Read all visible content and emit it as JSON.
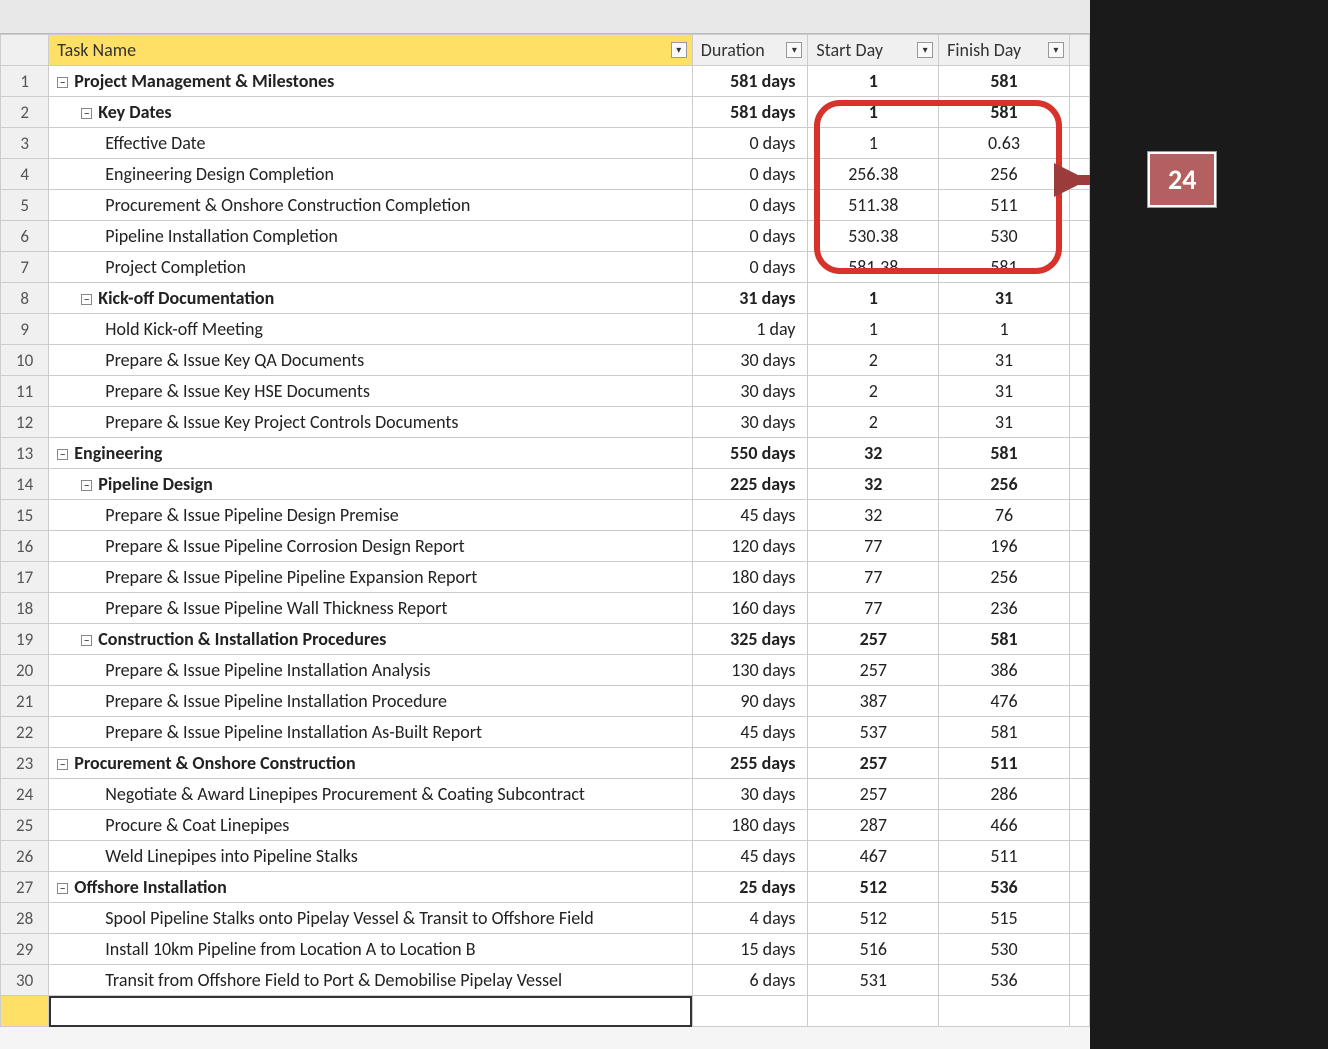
{
  "callout": {
    "label": "24"
  },
  "headers": {
    "task": "Task Name",
    "duration": "Duration",
    "start": "Start Day",
    "finish": "Finish Day"
  },
  "rows": [
    {
      "n": "1",
      "bold": true,
      "lvl": 0,
      "toggle": true,
      "name": "Project Management & Milestones",
      "dur": "581 days",
      "start": "1",
      "finish": "581"
    },
    {
      "n": "2",
      "bold": true,
      "lvl": 1,
      "toggle": true,
      "name": "Key Dates",
      "dur": "581 days",
      "start": "1",
      "finish": "581"
    },
    {
      "n": "3",
      "bold": false,
      "lvl": 2,
      "toggle": false,
      "name": "Effective Date",
      "dur": "0 days",
      "start": "1",
      "finish": "0.63"
    },
    {
      "n": "4",
      "bold": false,
      "lvl": 2,
      "toggle": false,
      "name": "Engineering Design Completion",
      "dur": "0 days",
      "start": "256.38",
      "finish": "256"
    },
    {
      "n": "5",
      "bold": false,
      "lvl": 2,
      "toggle": false,
      "name": "Procurement & Onshore Construction Completion",
      "dur": "0 days",
      "start": "511.38",
      "finish": "511"
    },
    {
      "n": "6",
      "bold": false,
      "lvl": 2,
      "toggle": false,
      "name": "Pipeline Installation Completion",
      "dur": "0 days",
      "start": "530.38",
      "finish": "530"
    },
    {
      "n": "7",
      "bold": false,
      "lvl": 2,
      "toggle": false,
      "name": "Project Completion",
      "dur": "0 days",
      "start": "581.38",
      "finish": "581"
    },
    {
      "n": "8",
      "bold": true,
      "lvl": 1,
      "toggle": true,
      "name": "Kick-off Documentation",
      "dur": "31 days",
      "start": "1",
      "finish": "31"
    },
    {
      "n": "9",
      "bold": false,
      "lvl": 2,
      "toggle": false,
      "name": "Hold Kick-off Meeting",
      "dur": "1 day",
      "start": "1",
      "finish": "1"
    },
    {
      "n": "10",
      "bold": false,
      "lvl": 2,
      "toggle": false,
      "name": "Prepare & Issue Key QA Documents",
      "dur": "30 days",
      "start": "2",
      "finish": "31"
    },
    {
      "n": "11",
      "bold": false,
      "lvl": 2,
      "toggle": false,
      "name": "Prepare & Issue Key HSE Documents",
      "dur": "30 days",
      "start": "2",
      "finish": "31"
    },
    {
      "n": "12",
      "bold": false,
      "lvl": 2,
      "toggle": false,
      "name": "Prepare & Issue Key Project Controls Documents",
      "dur": "30 days",
      "start": "2",
      "finish": "31"
    },
    {
      "n": "13",
      "bold": true,
      "lvl": 0,
      "toggle": true,
      "name": "Engineering",
      "dur": "550 days",
      "start": "32",
      "finish": "581"
    },
    {
      "n": "14",
      "bold": true,
      "lvl": 1,
      "toggle": true,
      "name": "Pipeline Design",
      "dur": "225 days",
      "start": "32",
      "finish": "256"
    },
    {
      "n": "15",
      "bold": false,
      "lvl": 2,
      "toggle": false,
      "name": "Prepare & Issue Pipeline Design Premise",
      "dur": "45 days",
      "start": "32",
      "finish": "76"
    },
    {
      "n": "16",
      "bold": false,
      "lvl": 2,
      "toggle": false,
      "name": "Prepare & Issue Pipeline Corrosion Design Report",
      "dur": "120 days",
      "start": "77",
      "finish": "196"
    },
    {
      "n": "17",
      "bold": false,
      "lvl": 2,
      "toggle": false,
      "name": "Prepare & Issue Pipeline Pipeline Expansion Report",
      "dur": "180 days",
      "start": "77",
      "finish": "256"
    },
    {
      "n": "18",
      "bold": false,
      "lvl": 2,
      "toggle": false,
      "name": "Prepare & Issue Pipeline Wall Thickness Report",
      "dur": "160 days",
      "start": "77",
      "finish": "236"
    },
    {
      "n": "19",
      "bold": true,
      "lvl": 1,
      "toggle": true,
      "name": "Construction & Installation Procedures",
      "dur": "325 days",
      "start": "257",
      "finish": "581"
    },
    {
      "n": "20",
      "bold": false,
      "lvl": 2,
      "toggle": false,
      "name": "Prepare & Issue Pipeline Installation Analysis",
      "dur": "130 days",
      "start": "257",
      "finish": "386"
    },
    {
      "n": "21",
      "bold": false,
      "lvl": 2,
      "toggle": false,
      "name": "Prepare & Issue Pipeline Installation Procedure",
      "dur": "90 days",
      "start": "387",
      "finish": "476"
    },
    {
      "n": "22",
      "bold": false,
      "lvl": 2,
      "toggle": false,
      "name": "Prepare & Issue Pipeline Installation As-Built Report",
      "dur": "45 days",
      "start": "537",
      "finish": "581"
    },
    {
      "n": "23",
      "bold": true,
      "lvl": 0,
      "toggle": true,
      "name": "Procurement & Onshore Construction",
      "dur": "255 days",
      "start": "257",
      "finish": "511"
    },
    {
      "n": "24",
      "bold": false,
      "lvl": 2,
      "toggle": false,
      "name": "Negotiate & Award Linepipes Procurement & Coating Subcontract",
      "dur": "30 days",
      "start": "257",
      "finish": "286"
    },
    {
      "n": "25",
      "bold": false,
      "lvl": 2,
      "toggle": false,
      "name": "Procure & Coat Linepipes",
      "dur": "180 days",
      "start": "287",
      "finish": "466"
    },
    {
      "n": "26",
      "bold": false,
      "lvl": 2,
      "toggle": false,
      "name": "Weld Linepipes into Pipeline Stalks",
      "dur": "45 days",
      "start": "467",
      "finish": "511"
    },
    {
      "n": "27",
      "bold": true,
      "lvl": 0,
      "toggle": true,
      "name": "Offshore Installation",
      "dur": "25 days",
      "start": "512",
      "finish": "536"
    },
    {
      "n": "28",
      "bold": false,
      "lvl": 2,
      "toggle": false,
      "name": "Spool Pipeline Stalks onto Pipelay Vessel & Transit to Offshore Field",
      "dur": "4 days",
      "start": "512",
      "finish": "515"
    },
    {
      "n": "29",
      "bold": false,
      "lvl": 2,
      "toggle": false,
      "name": "Install 10km Pipeline from Location A to Location B",
      "dur": "15 days",
      "start": "516",
      "finish": "530"
    },
    {
      "n": "30",
      "bold": false,
      "lvl": 2,
      "toggle": false,
      "name": "Transit from Offshore Field to Port & Demobilise Pipelay Vessel",
      "dur": "6 days",
      "start": "531",
      "finish": "536"
    }
  ]
}
